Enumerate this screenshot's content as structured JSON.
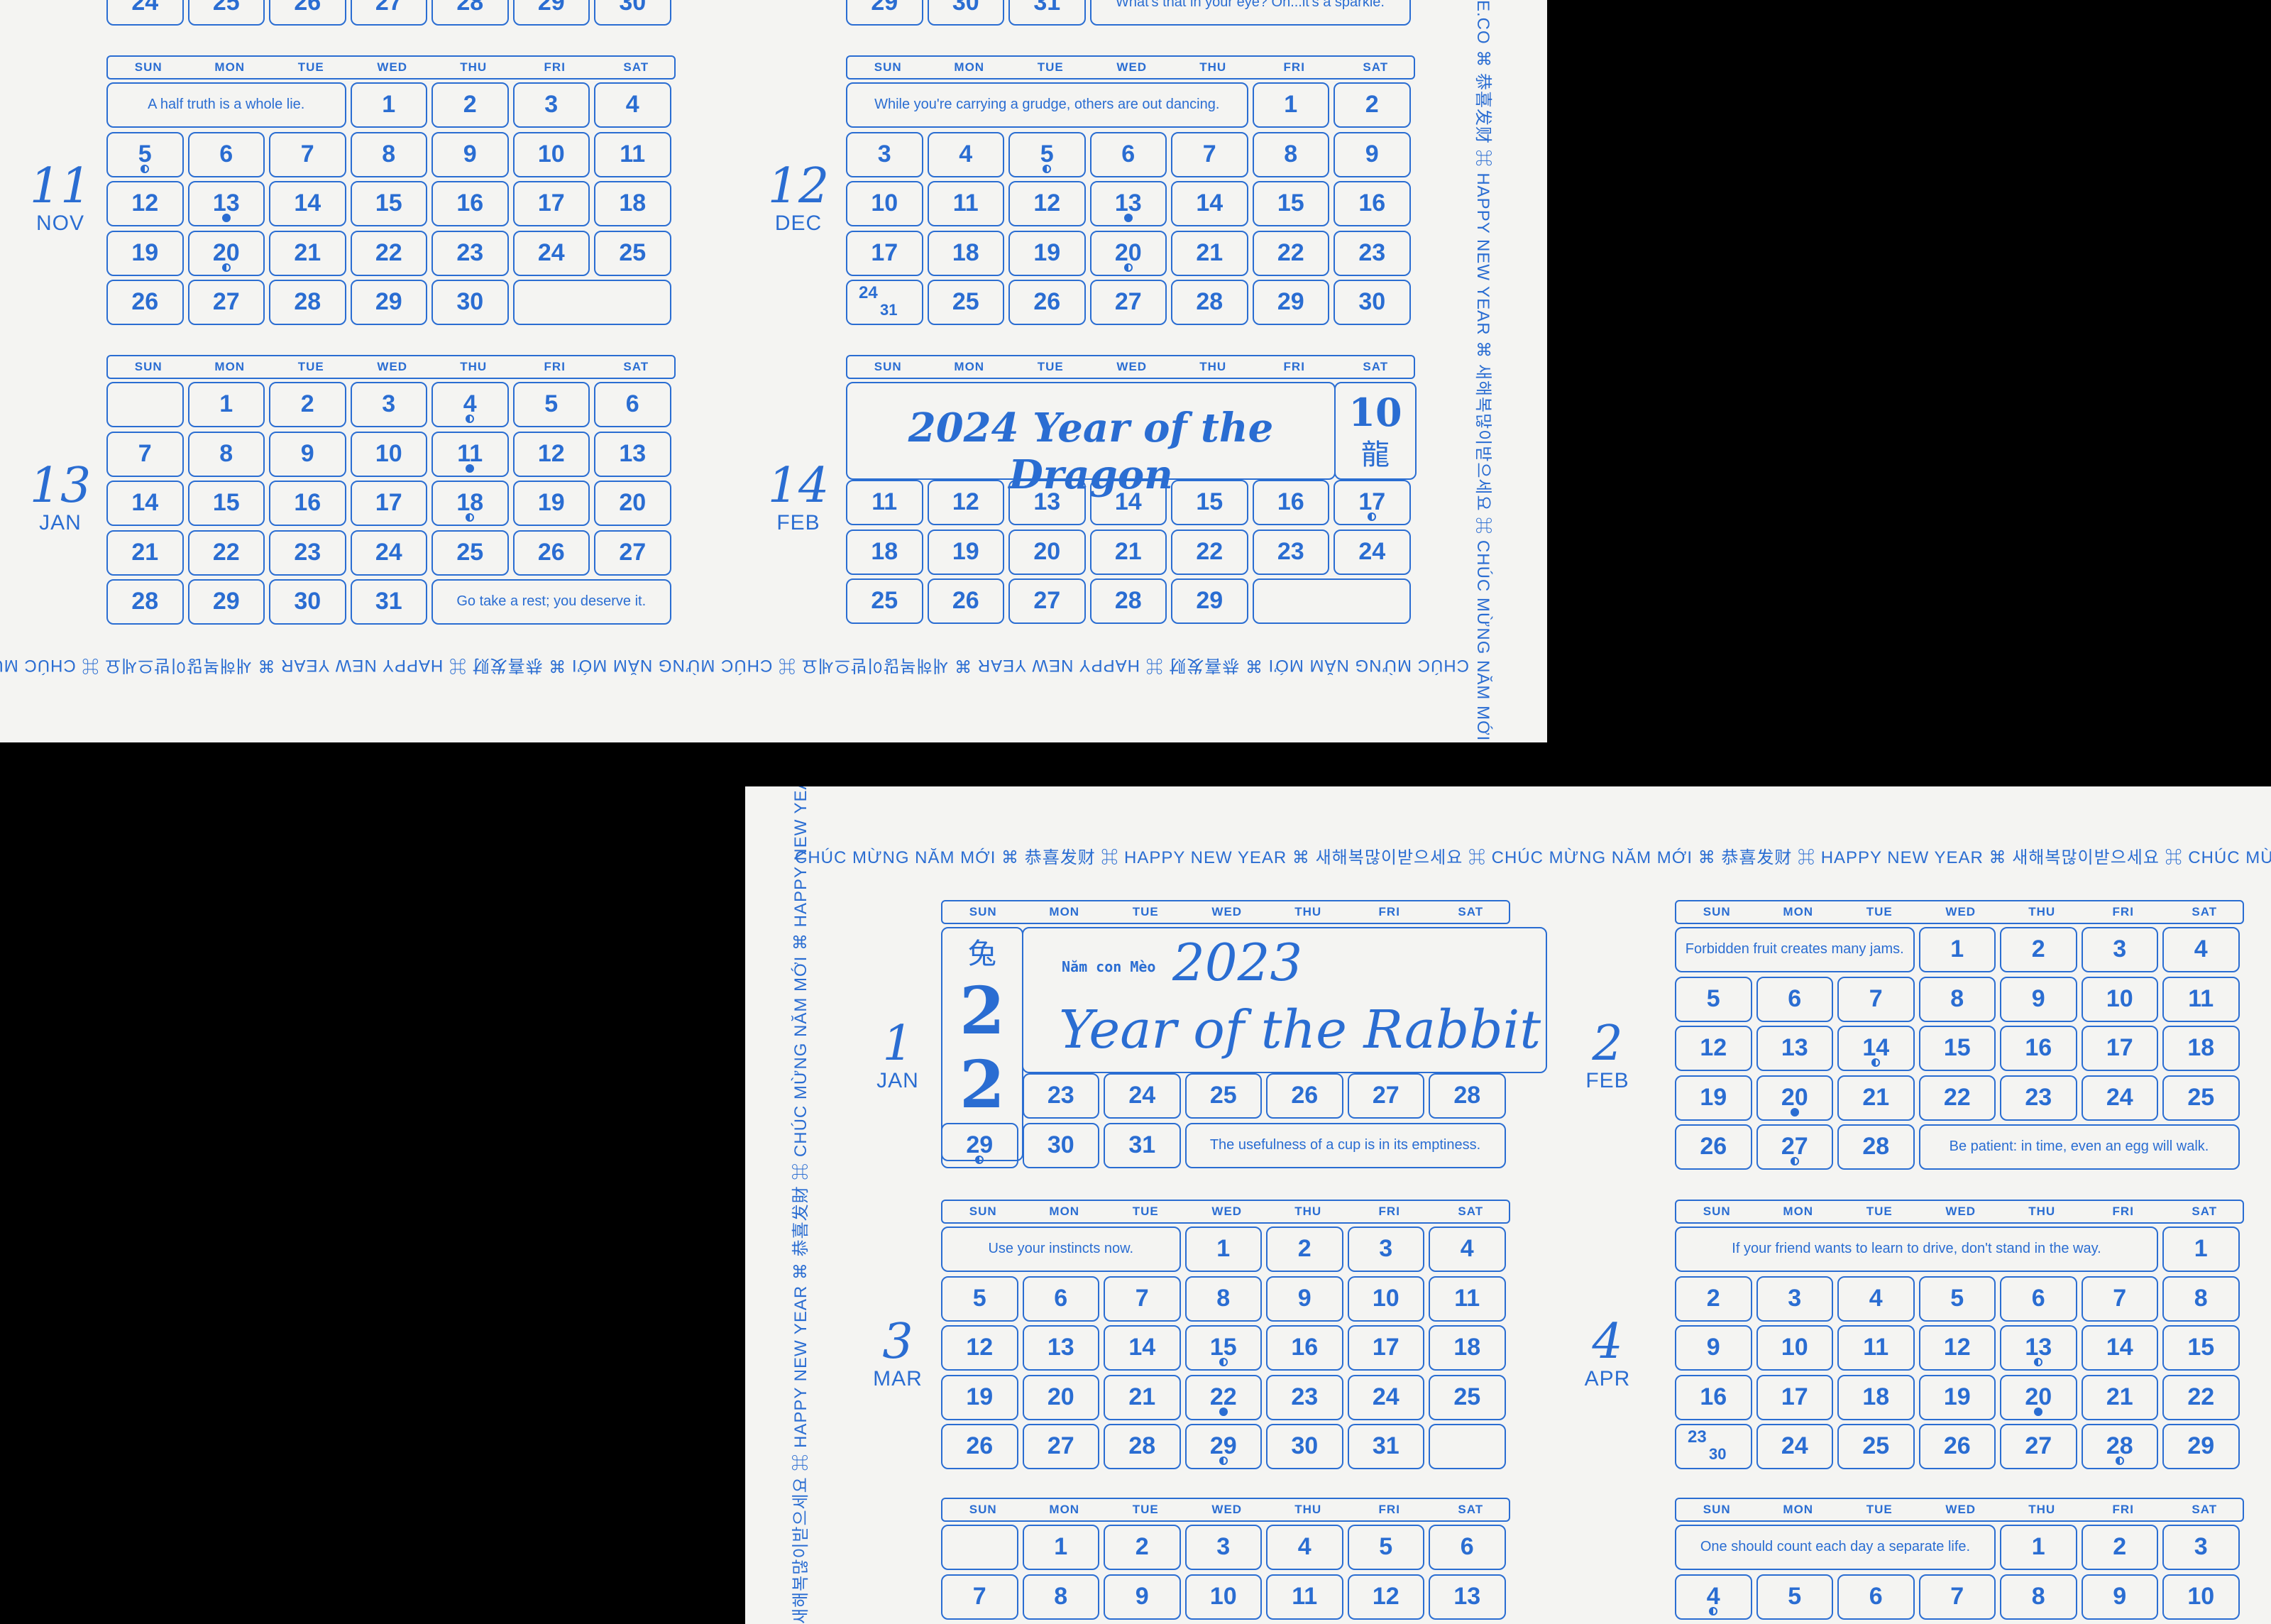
{
  "dow": [
    "SUN",
    "MON",
    "TUE",
    "WED",
    "THU",
    "FRI",
    "SAT"
  ],
  "greeting": "CHÚC MỪNG NĂM MỚI ⌘ 恭喜发财 ⌘ HAPPY NEW YEAR ⌘ 새해복많이받으세요 ⌘ CHÚC MỪNG NĂM MỚI ⌘ 恭喜发财 ⌘ HAPPY NEW YEAR ⌘ 새해복많이받으세요 ⌘ CHÚC MỪNG NĂM MỚI",
  "greeting_vert_a": "E.CO ⌘ 恭喜发财 ⌘ HAPPY NEW YEAR ⌘ 새해복많이받으세요 ⌘ CHÚC MỪNG NĂM MỚI",
  "greeting_vert_b": "새해복많이받으세요 ⌘ HAPPY NEW YEAR ⌘ 恭喜发財 ⌘ CHÚC MỪNG NĂM MỚI ⌘ HAPPY NEW YEAR",
  "sheetA": {
    "top_row_left": [
      "24",
      "25",
      "26",
      "27",
      "28",
      "29",
      "30"
    ],
    "top_row_right": [
      "29",
      "30",
      "31"
    ],
    "top_note_right": "What's that in your eye? Oh...it's a sparkle.",
    "nov": {
      "num": "11",
      "name": "NOV",
      "note": "A half truth is a whole lie.",
      "days": [
        "1",
        "2",
        "3",
        "4",
        "5",
        "6",
        "7",
        "8",
        "9",
        "10",
        "11",
        "12",
        "13",
        "14",
        "15",
        "16",
        "17",
        "18",
        "19",
        "20",
        "21",
        "22",
        "23",
        "24",
        "25",
        "26",
        "27",
        "28",
        "29",
        "30"
      ]
    },
    "dec": {
      "num": "12",
      "name": "DEC",
      "note": "While you're carrying a grudge, others are out dancing.",
      "days": [
        "1",
        "2",
        "3",
        "4",
        "5",
        "6",
        "7",
        "8",
        "9",
        "10",
        "11",
        "12",
        "13",
        "14",
        "15",
        "16",
        "17",
        "18",
        "19",
        "20",
        "21",
        "22",
        "23",
        "24",
        "25",
        "26",
        "27",
        "28",
        "29",
        "30"
      ],
      "split_a": "24",
      "split_b": "31"
    },
    "jan": {
      "num": "13",
      "name": "JAN",
      "note": "Go take a rest; you deserve it.",
      "days": [
        "1",
        "2",
        "3",
        "4",
        "5",
        "6",
        "7",
        "8",
        "9",
        "10",
        "11",
        "12",
        "13",
        "14",
        "15",
        "16",
        "17",
        "18",
        "19",
        "20",
        "21",
        "22",
        "23",
        "24",
        "25",
        "26",
        "27",
        "28",
        "29",
        "30",
        "31"
      ]
    },
    "feb": {
      "num": "14",
      "name": "FEB",
      "banner": "2024 Year of the Dragon",
      "badge_num": "10",
      "badge_char": "龍",
      "days": [
        "11",
        "12",
        "13",
        "14",
        "15",
        "16",
        "17",
        "18",
        "19",
        "20",
        "21",
        "22",
        "23",
        "24",
        "25",
        "26",
        "27",
        "28",
        "29"
      ]
    }
  },
  "sheetB": {
    "jan": {
      "num": "1",
      "name": "JAN",
      "big_char": "兔",
      "big_num_a": "2",
      "big_num_b": "2",
      "sub": "Năm con Mèo",
      "year": "2023",
      "title": "Year of the Rabbit",
      "note": "The usefulness of a cup is in its emptiness.",
      "days": [
        "23",
        "24",
        "25",
        "26",
        "27",
        "28",
        "29",
        "30",
        "31"
      ]
    },
    "feb": {
      "num": "2",
      "name": "FEB",
      "note_top": "Forbidden fruit creates many jams.",
      "note_bottom": "Be patient: in time, even an egg will walk.",
      "days": [
        "1",
        "2",
        "3",
        "4",
        "5",
        "6",
        "7",
        "8",
        "9",
        "10",
        "11",
        "12",
        "13",
        "14",
        "15",
        "16",
        "17",
        "18",
        "19",
        "20",
        "21",
        "22",
        "23",
        "24",
        "25",
        "26",
        "27",
        "28"
      ]
    },
    "mar": {
      "num": "3",
      "name": "MAR",
      "note": "Use your instincts now.",
      "days": [
        "1",
        "2",
        "3",
        "4",
        "5",
        "6",
        "7",
        "8",
        "9",
        "10",
        "11",
        "12",
        "13",
        "14",
        "15",
        "16",
        "17",
        "18",
        "19",
        "20",
        "21",
        "22",
        "23",
        "24",
        "25",
        "26",
        "27",
        "28",
        "29",
        "30",
        "31"
      ]
    },
    "apr": {
      "num": "4",
      "name": "APR",
      "note": "If your friend wants to learn to drive, don't stand in the way.",
      "days": [
        "1",
        "2",
        "3",
        "4",
        "5",
        "6",
        "7",
        "8",
        "9",
        "10",
        "11",
        "12",
        "13",
        "14",
        "15",
        "16",
        "17",
        "18",
        "19",
        "20",
        "21",
        "22",
        "23",
        "24",
        "25",
        "26",
        "27",
        "28",
        "29"
      ],
      "split_a": "23",
      "split_b": "30"
    },
    "may": {
      "note": "One should count each day a separate life.",
      "days": [
        "1",
        "2",
        "3",
        "4",
        "5",
        "6",
        "7",
        "8",
        "9",
        "10",
        "11",
        "12",
        "13"
      ]
    },
    "jun": {
      "days": [
        "1",
        "2",
        "3",
        "4",
        "5",
        "6",
        "7",
        "8",
        "9",
        "10"
      ]
    }
  }
}
